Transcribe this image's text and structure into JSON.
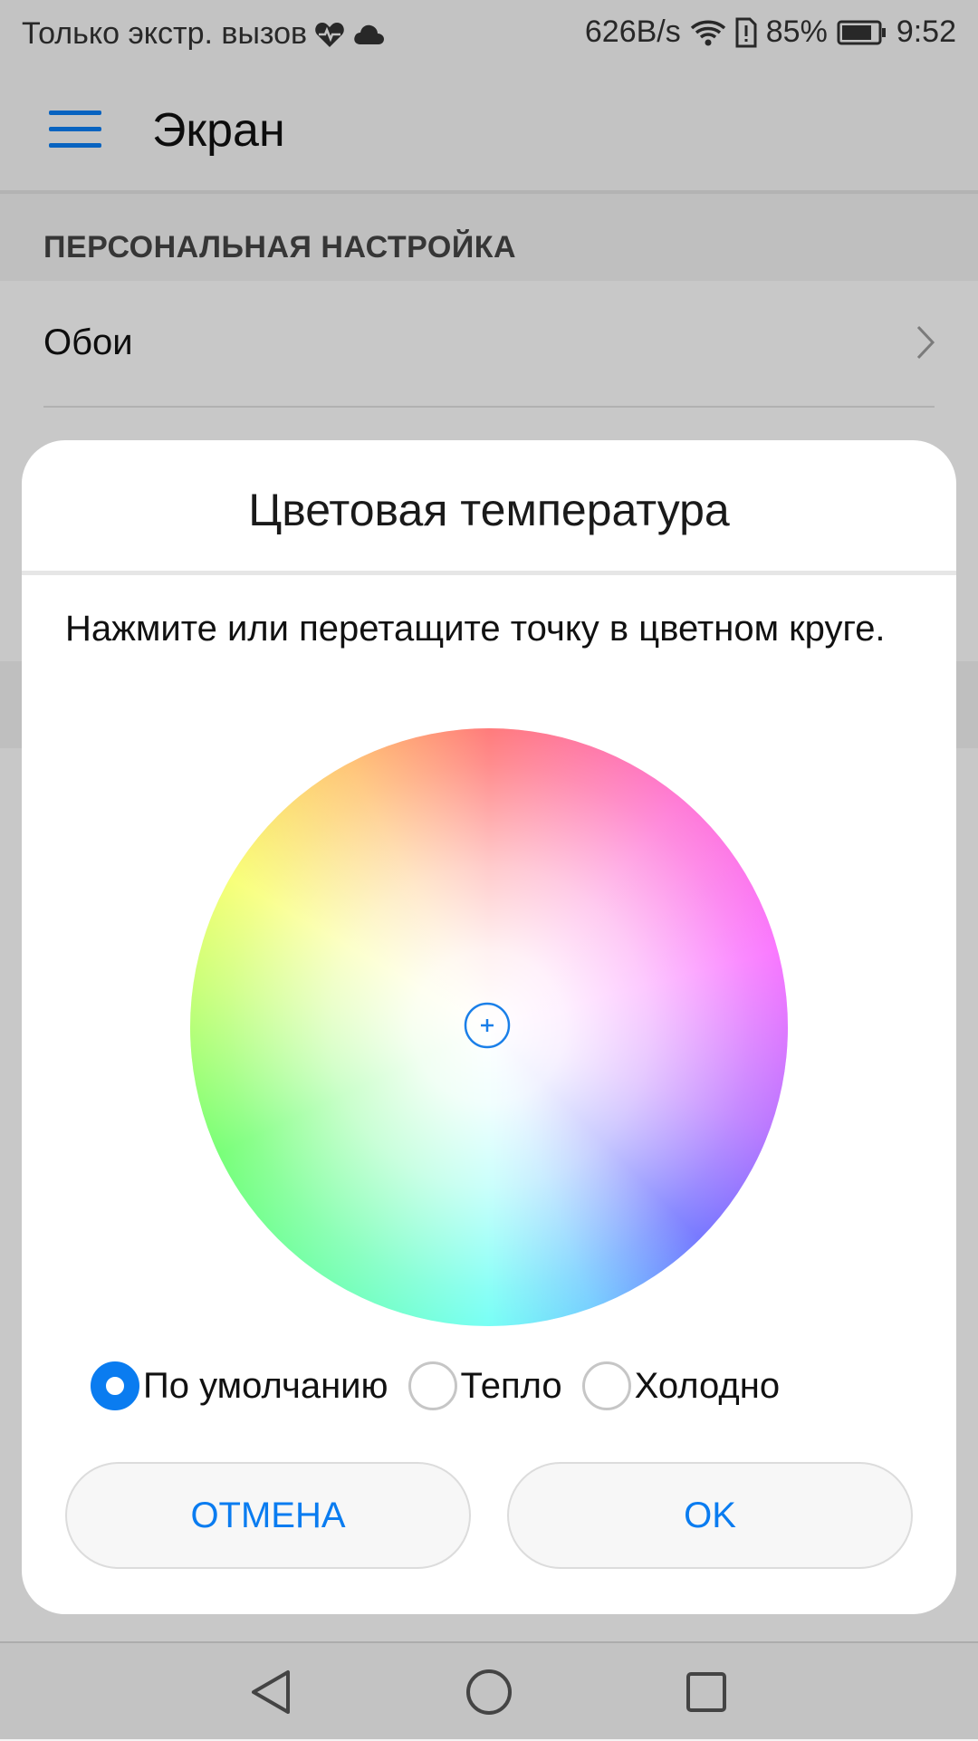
{
  "status_bar": {
    "carrier_text": "Только экстр. вызов",
    "heart_icon": "heart-pulse-icon",
    "cloud_icon": "cloud-icon",
    "network_speed": "626B/s",
    "wifi_icon": "wifi-icon",
    "sim_icon": "sim-alert-icon",
    "battery_percent": "85%",
    "battery_level": 0.85,
    "time": "9:52"
  },
  "toolbar": {
    "menu_icon": "hamburger-menu-icon",
    "title": "Экран"
  },
  "settings": {
    "section_header": "ПЕРСОНАЛЬНАЯ НАСТРОЙКА",
    "items": [
      {
        "label": "Обои",
        "icon": "chevron-right-icon"
      }
    ]
  },
  "dialog": {
    "title": "Цветовая температура",
    "instruction": "Нажмите или перетащите точку в цветном круге.",
    "wheel": {
      "handle_icon": "plus-circle-icon"
    },
    "options": [
      {
        "label": "По умолчанию",
        "checked": true
      },
      {
        "label": "Тепло",
        "checked": false
      },
      {
        "label": "Холодно",
        "checked": false
      }
    ],
    "cancel_label": "ОТМЕНА",
    "ok_label": "OK"
  },
  "nav_bar": {
    "back_icon": "back-triangle-icon",
    "home_icon": "home-circle-icon",
    "recents_icon": "recents-square-icon"
  },
  "colors": {
    "accent": "#0a7cf0",
    "scrim": "rgba(0,0,0,0.2)"
  }
}
